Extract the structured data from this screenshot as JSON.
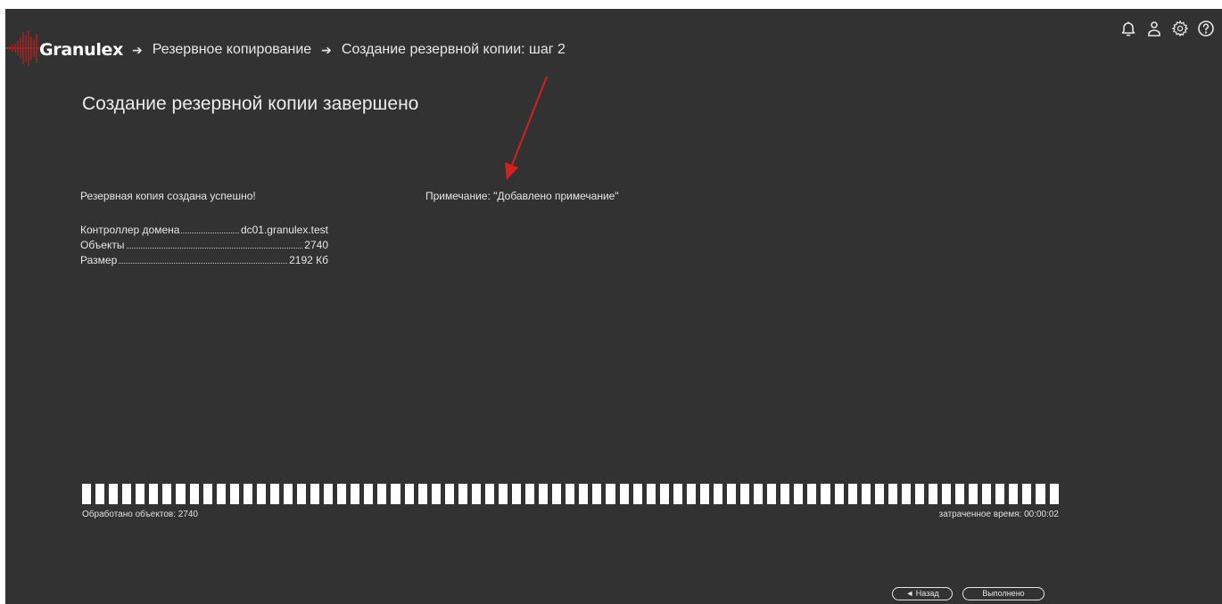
{
  "header": {
    "logo_text": "Granulex",
    "breadcrumb": [
      "Резервное копирование",
      "Создание резервной копии: шаг 2"
    ],
    "icons": [
      "bell-icon",
      "user-icon",
      "gear-icon",
      "help-icon"
    ]
  },
  "main": {
    "title": "Создание резервной копии завершено",
    "success_message": "Резервная копия создана успешно!",
    "note": "Примечание: \"Добавлено примечание\"",
    "info": [
      {
        "label": "Контроллер домена",
        "value": "dc01.granulex.test"
      },
      {
        "label": "Объекты",
        "value": "2740"
      },
      {
        "label": "Размер",
        "value": "2192 Кб"
      }
    ]
  },
  "progress": {
    "fraction": 1.0,
    "processed_label": "Обработано объектов: 2740",
    "elapsed_label": "затраченное время: 00:00:02"
  },
  "footer": {
    "back_label": "◄ Назад",
    "done_label": "Выполнено"
  },
  "colors": {
    "background": "#323232",
    "text": "#e6e6e6",
    "accent_red": "#d42020"
  }
}
